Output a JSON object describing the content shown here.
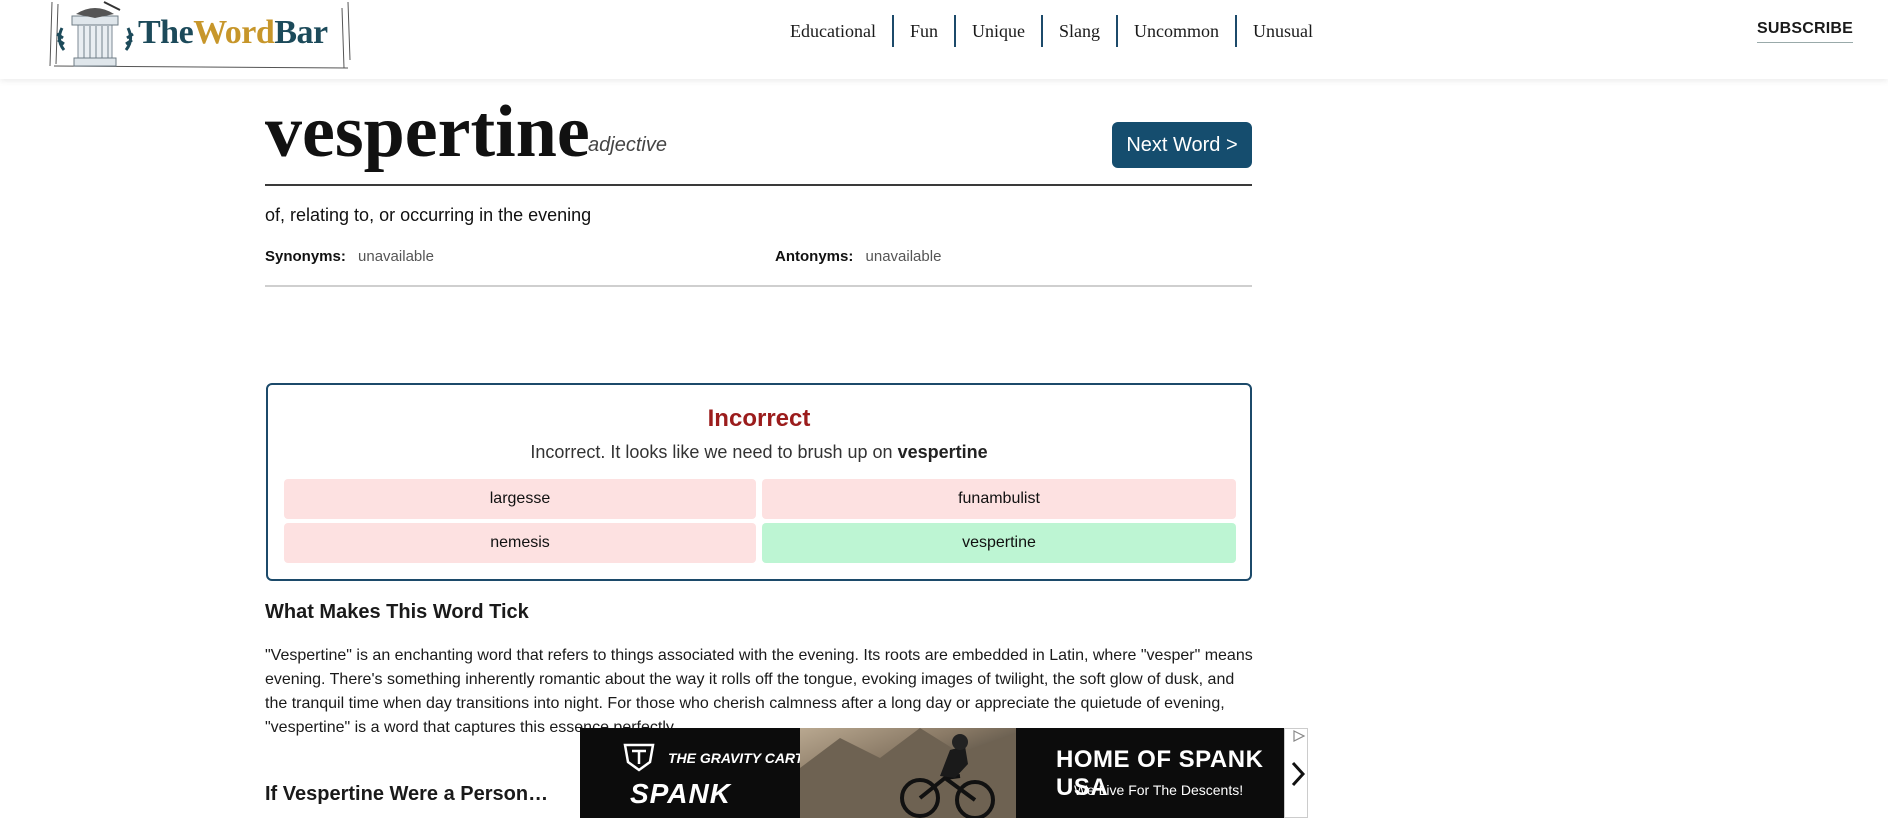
{
  "header": {
    "brand": {
      "the": "The",
      "word": "Word",
      "bar": "Bar"
    },
    "nav": [
      "Educational",
      "Fun",
      "Unique",
      "Slang",
      "Uncommon",
      "Unusual"
    ],
    "subscribe": "SUBSCRIBE"
  },
  "entry": {
    "word": "vespertine",
    "part_of_speech": "adjective",
    "next_button": "Next Word >",
    "definition": "of, relating to, or occurring in the evening",
    "synonyms_label": "Synonyms:",
    "synonyms_value": "unavailable",
    "antonyms_label": "Antonyms:",
    "antonyms_value": "unavailable"
  },
  "quiz": {
    "status": "Incorrect",
    "message_prefix": "Incorrect. It looks like we need to brush up on",
    "message_word": "vespertine",
    "options": [
      {
        "label": "largesse",
        "state": "wrong"
      },
      {
        "label": "funambulist",
        "state": "wrong"
      },
      {
        "label": "nemesis",
        "state": "wrong"
      },
      {
        "label": "vespertine",
        "state": "correct"
      }
    ]
  },
  "article": {
    "heading1": "What Makes This Word Tick",
    "paragraph1": "\"Vespertine\" is an enchanting word that refers to things associated with the evening. Its roots are embedded in Latin, where \"vesper\" means evening. There's something inherently romantic about the way it rolls off the tongue, evoking images of twilight, the soft glow of dusk, and the tranquil time when day transitions into night. For those who cherish calmness after a long day or appreciate the quietude of evening, \"vespertine\" is a word that captures this essence perfectly.",
    "heading2": "If Vespertine Were a Person…"
  },
  "ad": {
    "brand_line": "THE GRAVITY CARTEL",
    "brand": "SPANK",
    "headline": "HOME OF SPANK USA",
    "tagline": "We Live For The Descents!"
  }
}
